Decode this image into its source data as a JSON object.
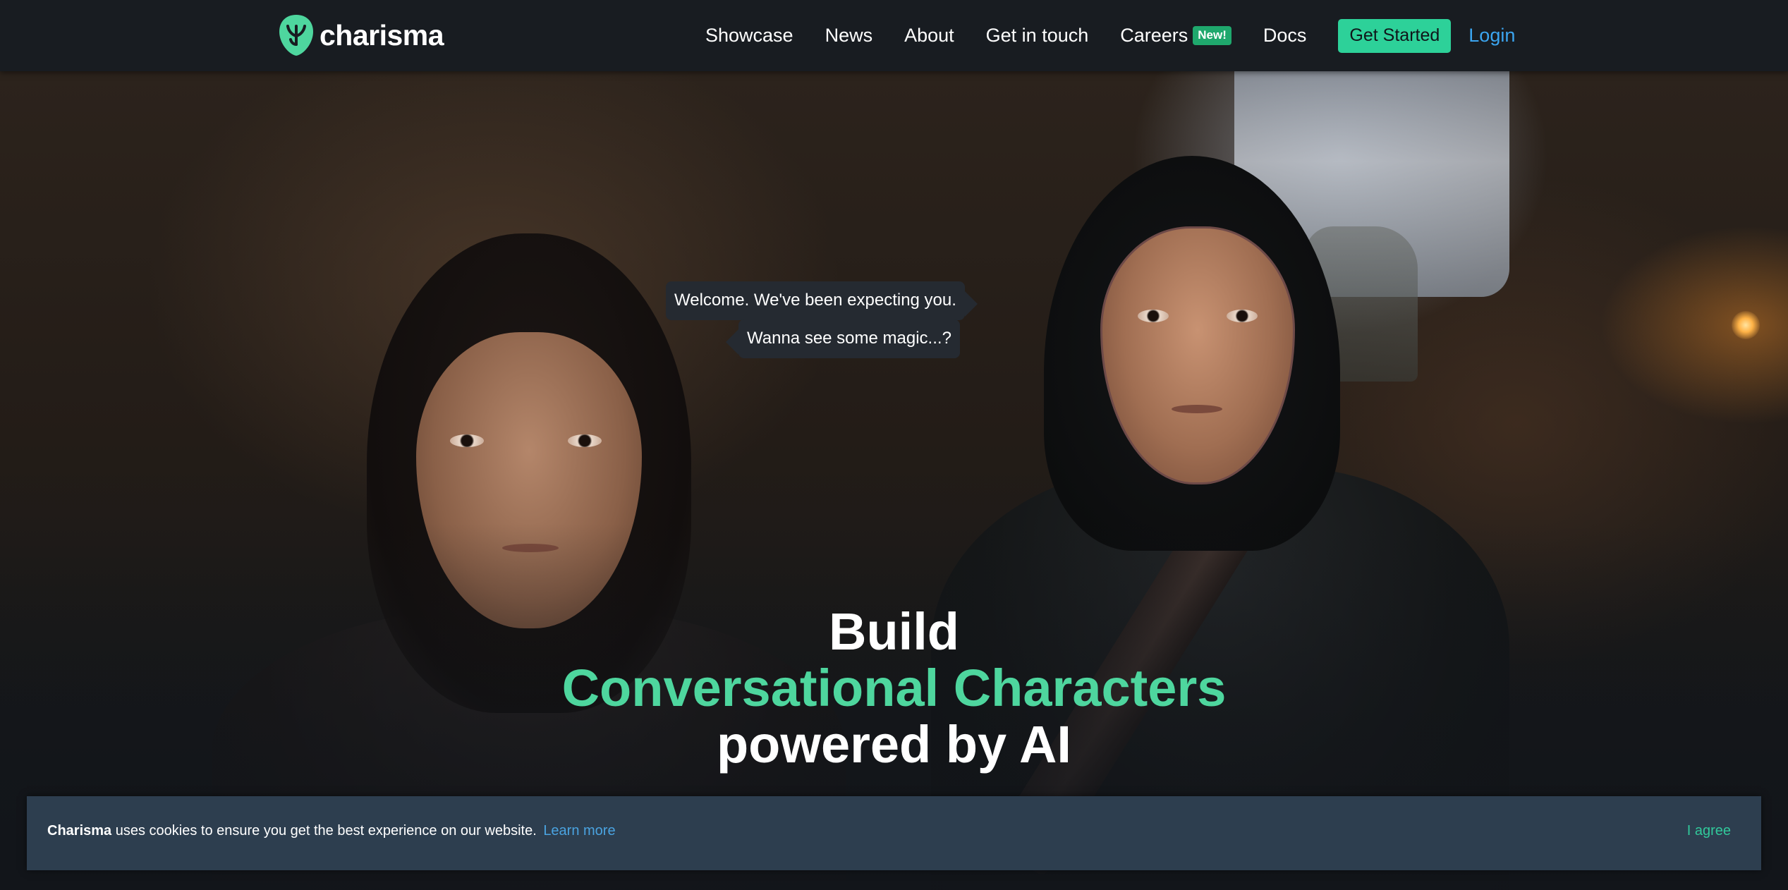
{
  "brand": {
    "name": "charisma",
    "logo_icon": "alien-leaf-icon",
    "logo_color": "#4ed69e"
  },
  "nav": {
    "links": [
      "Showcase",
      "News",
      "About",
      "Get in touch",
      "Careers",
      "Docs"
    ],
    "careers_badge": "New!",
    "cta_label": "Get Started",
    "login_label": "Login"
  },
  "hero": {
    "bubble_1": "Welcome. We've been expecting you.",
    "bubble_2": "Wanna see some magic...?",
    "headline_1": "Build",
    "headline_2": "Conversational Characters",
    "headline_3": "powered by AI"
  },
  "cookie": {
    "brand": "Charisma",
    "message": " uses cookies to ensure you get the best experience on our website.",
    "learn_more": "Learn more",
    "agree": "I agree"
  },
  "colors": {
    "accent_green": "#4ed69e",
    "cta_green": "#2dd199",
    "link_blue": "#3ba5f0",
    "nav_bg": "#181c21",
    "cookie_bg": "#2d3e4f"
  }
}
